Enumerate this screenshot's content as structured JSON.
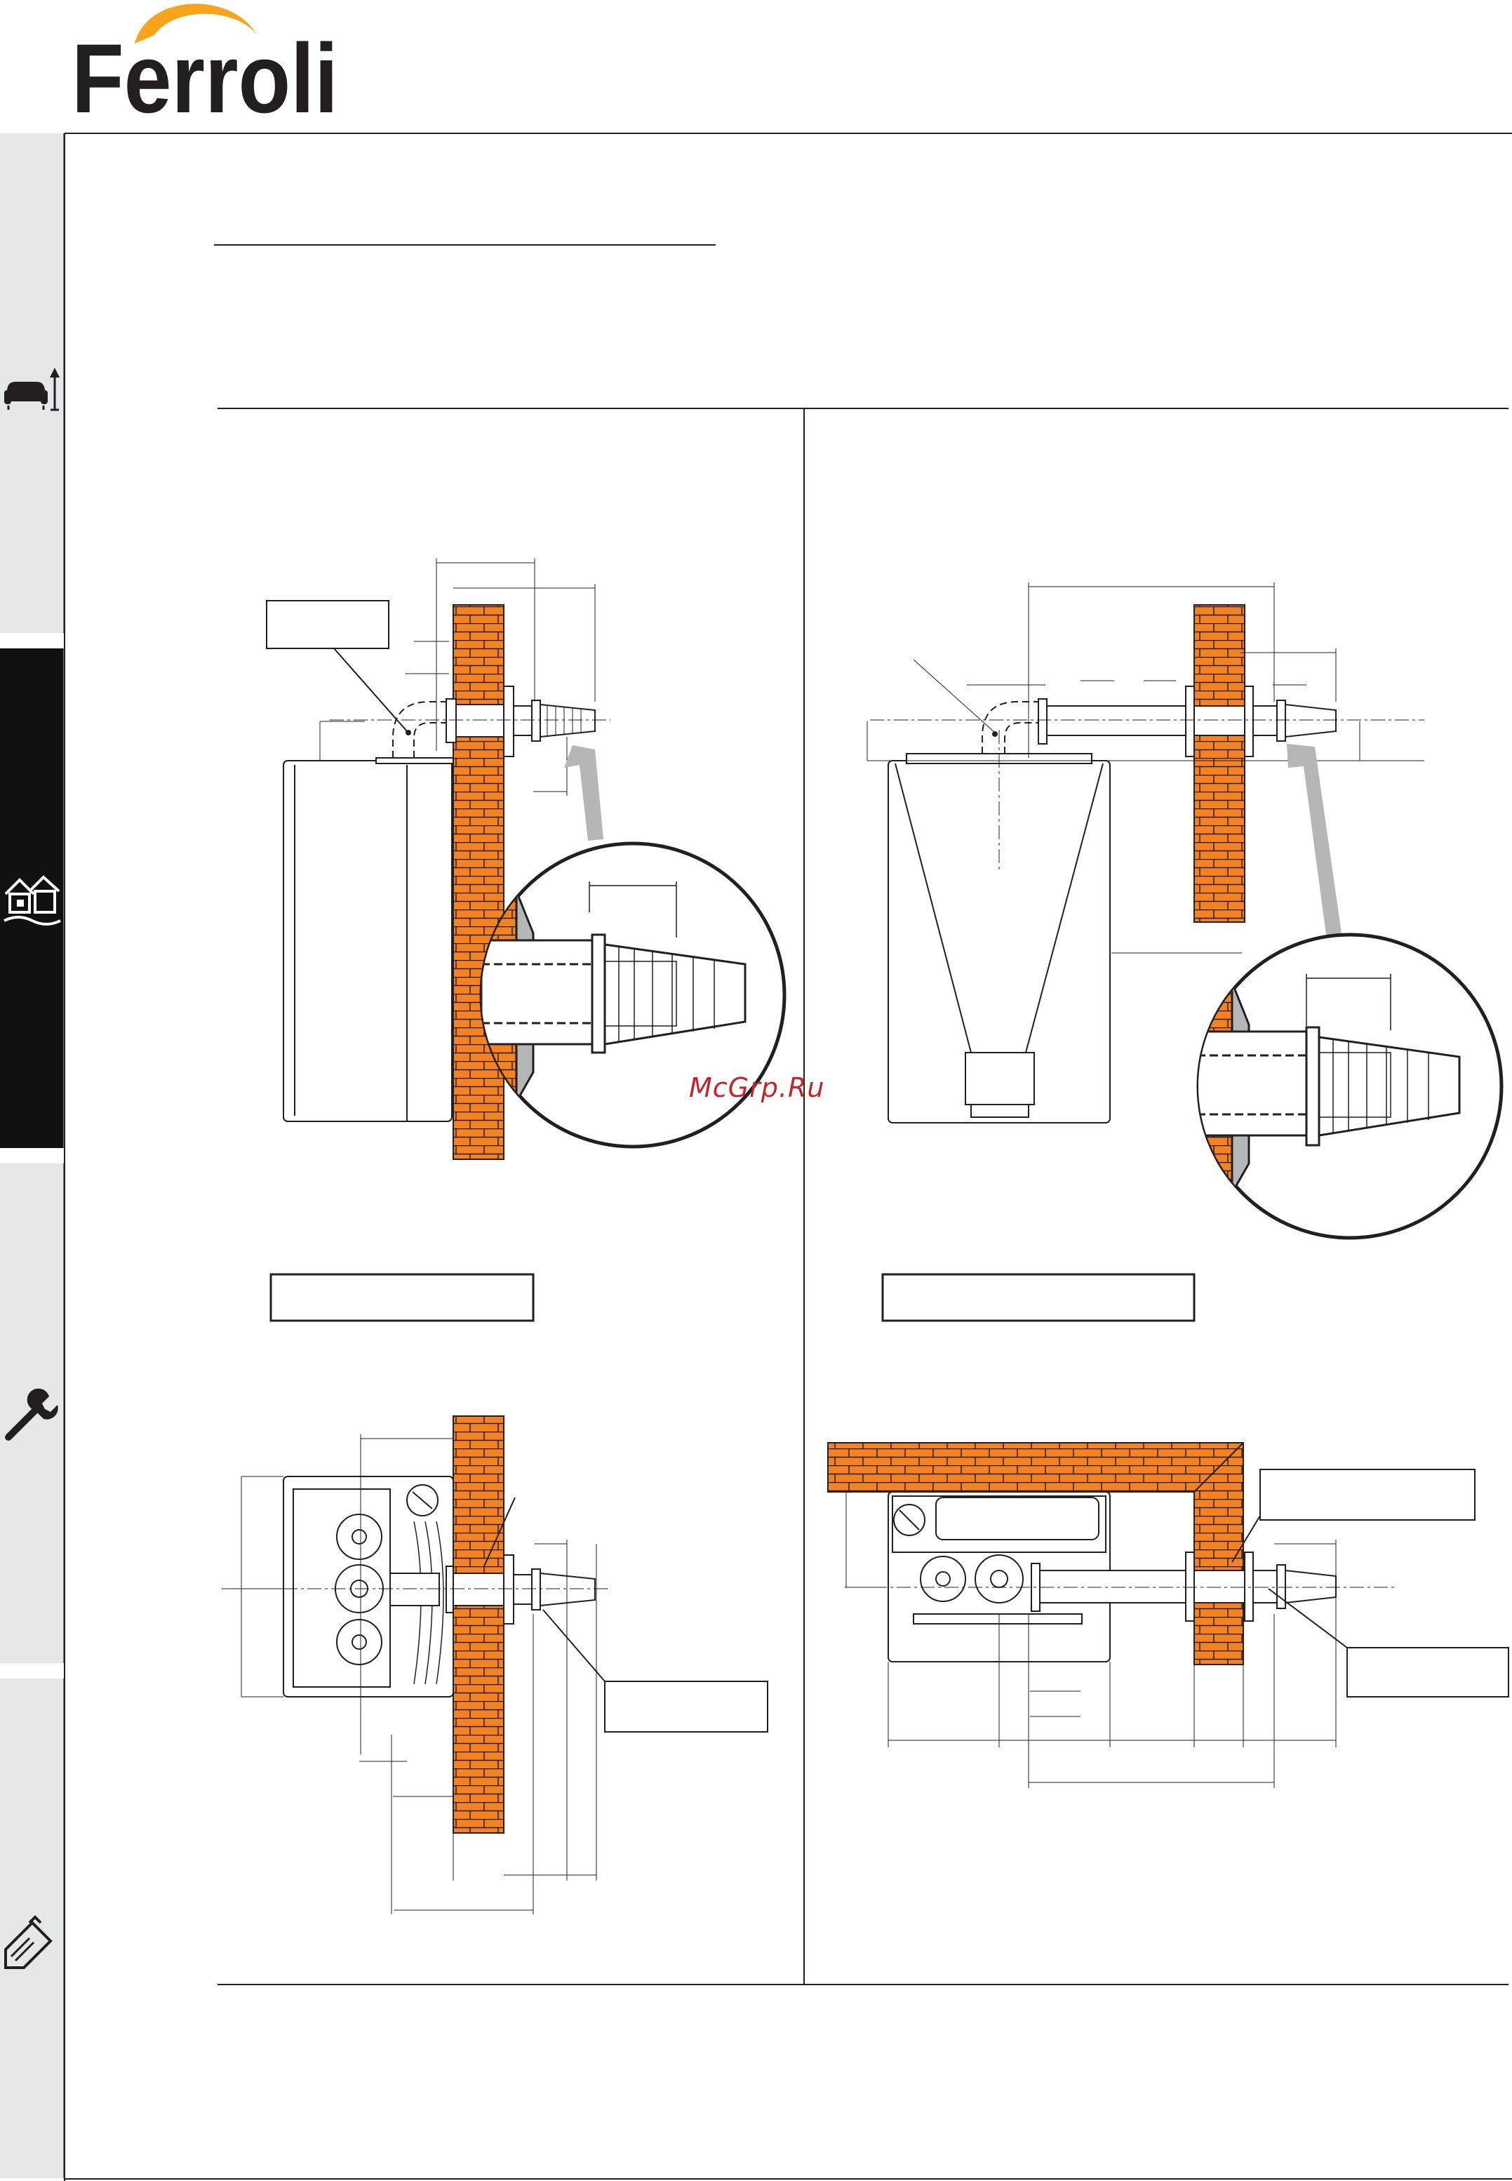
{
  "brand": {
    "name": "Ferroli",
    "text_color": "#231f20",
    "accent_color": "#f7a51c"
  },
  "sidebar": {
    "tabs": [
      {
        "icon": "armchair-lamp-icon",
        "active": false
      },
      {
        "icon": "house-installation-icon",
        "active": true
      },
      {
        "icon": "wrench-icon",
        "active": false
      },
      {
        "icon": "clipboard-pencil-icon",
        "active": false
      }
    ],
    "tab_color": "#e6e7e8",
    "active_tab_color": "#111111"
  },
  "watermark": {
    "text": "McGrp.Ru",
    "color": "#c0262d"
  },
  "colors": {
    "brick": "#f58220",
    "arrow": "#b5b6b8"
  }
}
